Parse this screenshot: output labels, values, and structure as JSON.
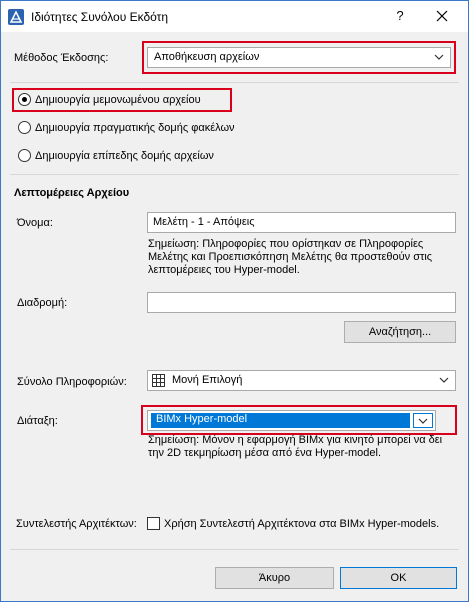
{
  "window": {
    "title": "Ιδιότητες Συνόλου Εκδότη",
    "help_label": "?"
  },
  "method": {
    "label": "Μέθοδος Έκδοσης:",
    "value": "Αποθήκευση αρχείων"
  },
  "options": [
    {
      "label": "Δημιουργία μεμονωμένου αρχείου",
      "selected": true
    },
    {
      "label": "Δημιουργία πραγματικής δομής φακέλων",
      "selected": false
    },
    {
      "label": "Δημιουργία επίπεδης δομής αρχείων",
      "selected": false
    }
  ],
  "file_details": {
    "heading": "Λεπτομέρειες Αρχείου",
    "name_label": "Όνομα:",
    "name_value": "Μελέτη - 1 - Απόψεις",
    "name_note": "Σημείωση: Πληροφορίες που ορίστηκαν σε Πληροφορίες Μελέτης και Προεπισκόπηση Μελέτης θα προστεθούν στις λεπτομέρειες του Hyper-model.",
    "path_label": "Διαδρομή:",
    "path_value": "",
    "browse_label": "Αναζήτηση..."
  },
  "infoset": {
    "label": "Σύνολο Πληροφοριών:",
    "value": "Μονή Επιλογή",
    "icon": "grid-icon"
  },
  "layout": {
    "label": "Διάταξη:",
    "value": "BIMx Hyper-model",
    "note": "Σημείωση: Μόνον η εφαρμογή BIMx για κινητό μπορεί να δει την 2D τεκμηρίωση μέσα από ένα Hyper-model."
  },
  "architects": {
    "label": "Συντελεστής Αρχιτέκτων:",
    "checkbox_label": "Χρήση Συντελεστή Αρχιτέκτονα στα BIMx Hyper-models.",
    "checked": false
  },
  "footer": {
    "cancel_label": "Άκυρο",
    "ok_label": "OK"
  },
  "colors": {
    "highlight": "#d9001b",
    "selection": "#0078d7"
  }
}
